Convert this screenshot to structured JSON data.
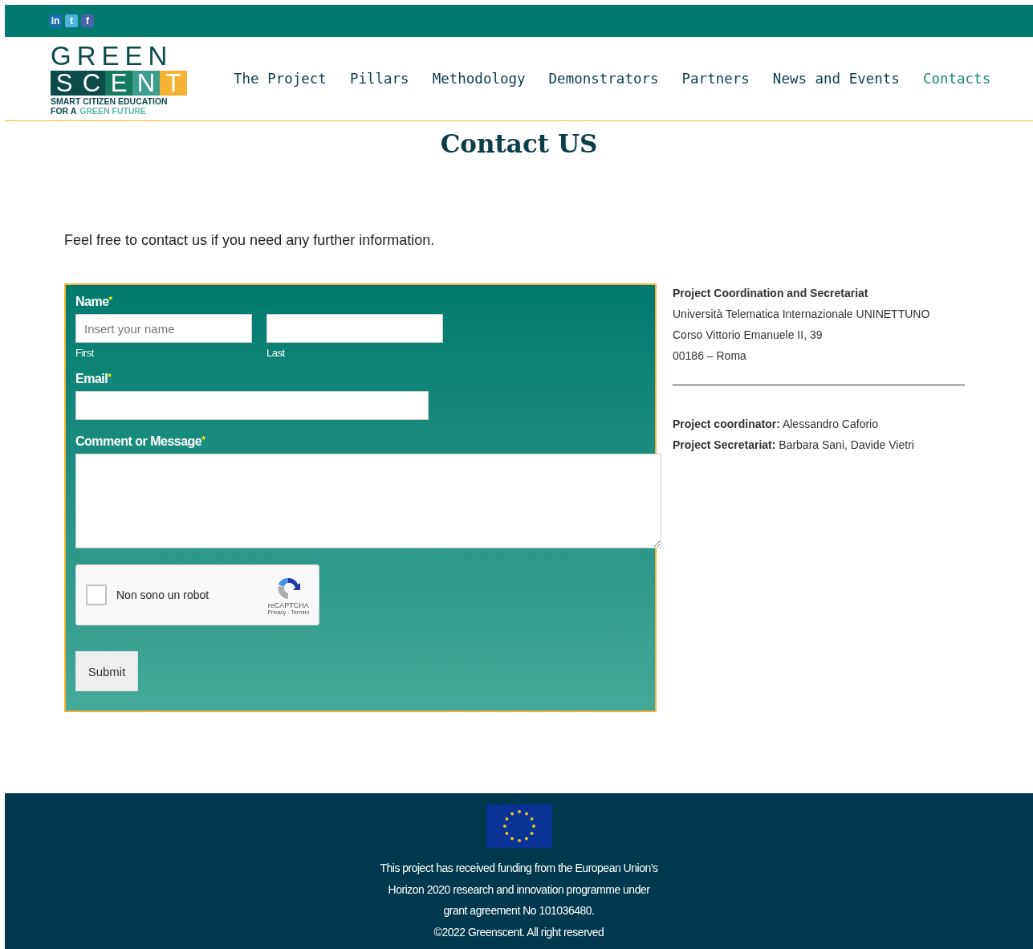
{
  "social": [
    "in",
    "t",
    "f"
  ],
  "logo": {
    "top": "GREEN",
    "letters": [
      {
        "char": "S",
        "color": "#0c4a4b"
      },
      {
        "char": "C",
        "color": "#0c4a4b"
      },
      {
        "char": "E",
        "color": "#137a5f"
      },
      {
        "char": "N",
        "color": "#3e9d8c"
      },
      {
        "char": "T",
        "color": "#f6b232"
      }
    ],
    "tagline": "SMART CITIZEN EDUCATION",
    "tagline_prefix": "FOR A",
    "tagline_highlight": "GREEN FUTURE"
  },
  "nav": [
    {
      "label": "The Project",
      "selected": false
    },
    {
      "label": "Pillars",
      "selected": false
    },
    {
      "label": "Methodology",
      "selected": false
    },
    {
      "label": "Demonstrators",
      "selected": false
    },
    {
      "label": "Partners",
      "selected": false
    },
    {
      "label": "News and Events",
      "selected": false
    },
    {
      "label": "Contacts",
      "selected": true
    }
  ],
  "title": "Contact US",
  "intro": "Feel free to contact us if you need any further information.",
  "form": {
    "name_label": "Name",
    "required_mark": "*",
    "first": {
      "placeholder": "Insert your name",
      "sublabel": "First"
    },
    "last": {
      "sublabel": "Last"
    },
    "email_label": "Email",
    "message_label": "Comment or Message",
    "captcha": {
      "label": "Non sono un robot",
      "checked": false,
      "brand": "reCAPTCHA",
      "links": "Privacy - Termini"
    },
    "submit": "Submit"
  },
  "info": {
    "heading": "Project Coordination and Secretariat",
    "lines": [
      "Università Telematica Internazionale UNINETTUNO",
      "Corso Vittorio Emanuele II, 39",
      "00186 – Roma"
    ],
    "people": [
      {
        "role": "Project coordinator:",
        "names": "Alessandro Caforio"
      },
      {
        "role": "Project Secretariat:",
        "names": "Barbara Sani, Davide Vietri"
      }
    ]
  },
  "footer": {
    "lines": [
      "This project has received funding from the European Union’s",
      "Horizon 2020 research and innovation programme under",
      "grant agreement No 101036480.",
      "©2022 Greenscent. All right reserved"
    ]
  }
}
